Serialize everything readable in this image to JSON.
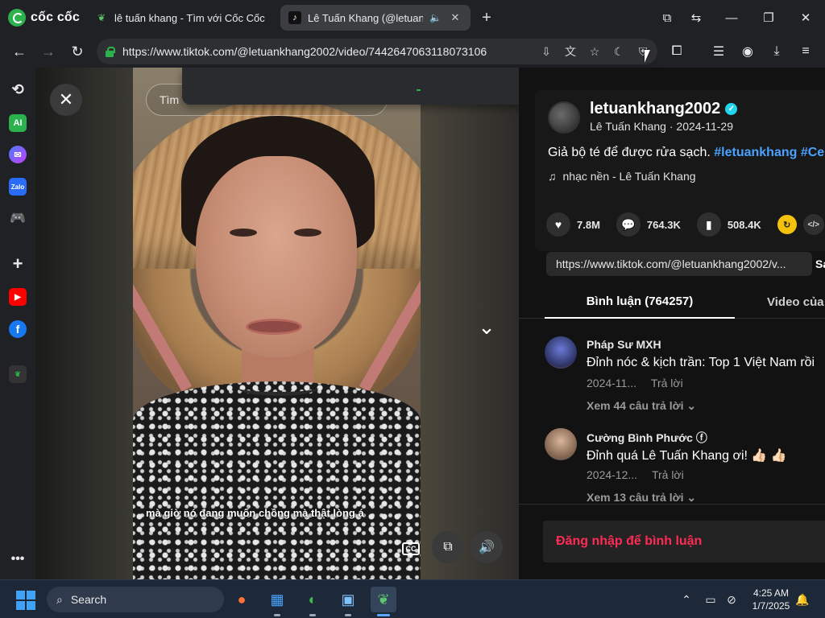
{
  "browser": {
    "brand_name": "cốc cốc",
    "tabs": [
      {
        "title": "lê tuấn khang - Tìm với Cốc Cốc",
        "active": false
      },
      {
        "title": "Lê Tuấn Khang (@letuank",
        "active": true
      }
    ],
    "url": "https://www.tiktok.com/@letuankhang2002/video/7442647063118073106",
    "accent": "#2bb24c"
  },
  "video": {
    "search_placeholder": "Tìm",
    "subtitle": "mà giờ nó đang muốn chồng mà thật lòng á",
    "cc_label": "CC"
  },
  "post": {
    "username": "letuankhang2002",
    "meta": "Lê Tuấn Khang · 2024-11-29",
    "description": "Giả bộ té để được rửa sạch.",
    "hashtag_1": "#letuankhang",
    "hashtag_2": "#Ce",
    "music": "nhạc nền - Lê Tuấn Khang",
    "likes": "7.8M",
    "comments": "764.3K",
    "saves": "508.4K",
    "link": "https://www.tiktok.com/@letuankhang2002/v...",
    "copy_label": "Sa",
    "tab_comments": "Bình luận (764257)",
    "tab_videos": "Video của n",
    "accent_red": "#fe2c55",
    "hashtag_color": "#4aa3ff"
  },
  "comments": [
    {
      "name": "Pháp Sư MXH",
      "text": "Đỉnh nóc & kịch trần: Top 1 Việt Nam rồi",
      "date": "2024-11...",
      "reply": "Trả lời",
      "more": "Xem 44 câu trả lời ⌄"
    },
    {
      "name": "Cường Bình Phước ⓕ",
      "text": "Đỉnh quá Lê Tuấn Khang ơi! 👍🏻 👍🏻",
      "date": "2024-12...",
      "reply": "Trả lời",
      "more": "Xem 13 câu trả lời ⌄"
    }
  ],
  "login_prompt": "Đăng nhập để bình luận",
  "taskbar": {
    "search_label": "Search",
    "time": "4:25 AM",
    "date": "1/7/2025"
  }
}
